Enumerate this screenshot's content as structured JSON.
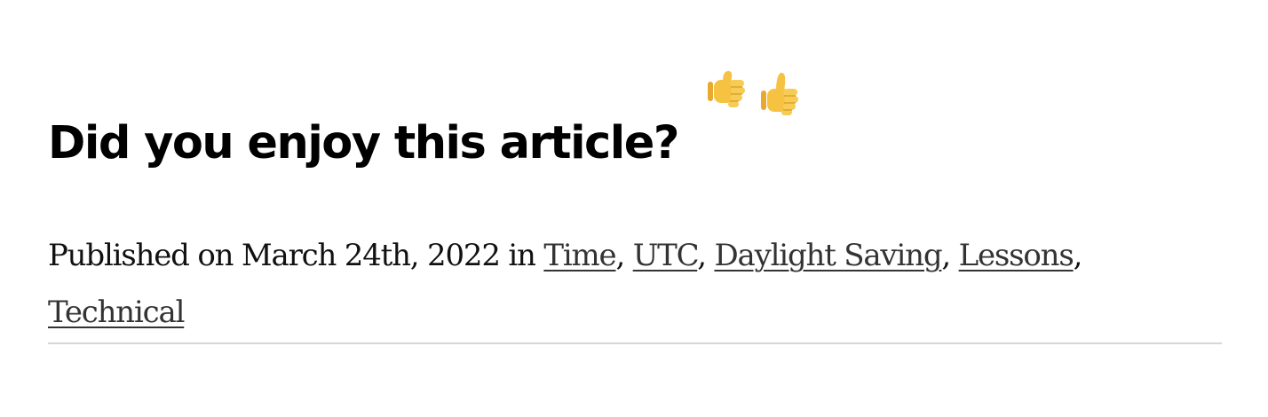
{
  "feedback": {
    "question": "Did you enjoy this article?",
    "dislike_icon": "thumbs-down-emoji",
    "like_icon": "thumbs-up-emoji",
    "emoji_color": "#F5C242"
  },
  "meta": {
    "published_prefix": "Published on March 24th, 2022 in ",
    "tags": [
      {
        "label": "Time"
      },
      {
        "label": "UTC"
      },
      {
        "label": "Daylight Saving"
      },
      {
        "label": "Lessons"
      },
      {
        "label": "Technical"
      }
    ],
    "separator": ", "
  },
  "colors": {
    "heading": "#000000",
    "link": "#333333",
    "divider": "#d6d6d6"
  }
}
